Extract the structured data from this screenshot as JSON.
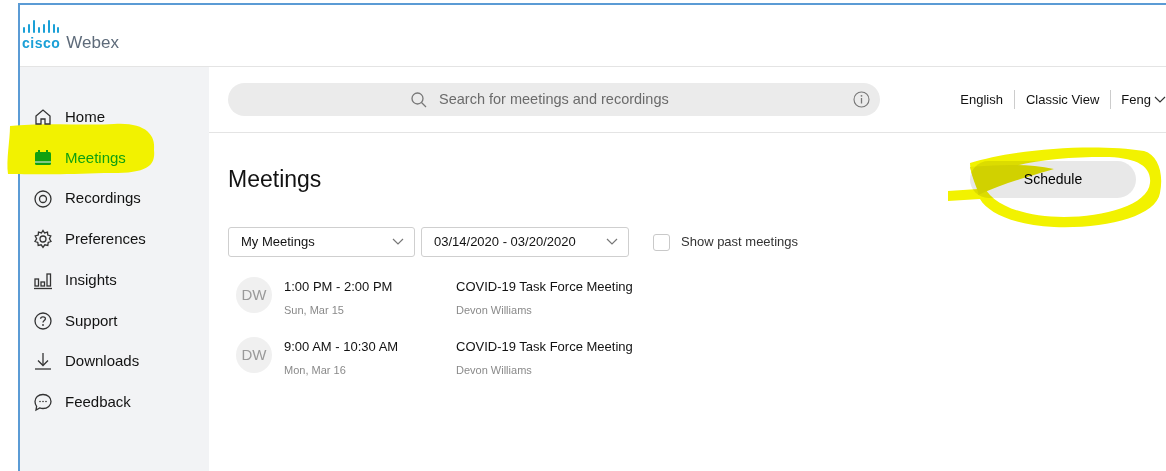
{
  "logo": {
    "brand": "cisco",
    "product": "Webex"
  },
  "sidebar": {
    "items": [
      {
        "label": "Home",
        "kind": "home",
        "selected": false
      },
      {
        "label": "Meetings",
        "kind": "calendar",
        "selected": true
      },
      {
        "label": "Recordings",
        "kind": "record",
        "selected": false
      },
      {
        "label": "Preferences",
        "kind": "gear",
        "selected": false
      },
      {
        "label": "Insights",
        "kind": "chart",
        "selected": false
      },
      {
        "label": "Support",
        "kind": "help",
        "selected": false
      },
      {
        "label": "Downloads",
        "kind": "download",
        "selected": false
      },
      {
        "label": "Feedback",
        "kind": "chat",
        "selected": false
      }
    ]
  },
  "search": {
    "placeholder": "Search for meetings and recordings"
  },
  "top_links": [
    "English",
    "Classic View"
  ],
  "user_menu": {
    "label": "Feng"
  },
  "page_title": "Meetings",
  "schedule_button": "Schedule",
  "filters": {
    "scope": "My Meetings",
    "date_range": "03/14/2020 - 03/20/2020",
    "show_past": {
      "label": "Show past meetings",
      "checked": false
    }
  },
  "meetings": [
    {
      "initials": "DW",
      "time": "1:00 PM - 2:00 PM",
      "date": "Sun, Mar 15",
      "title": "COVID-19 Task Force Meeting",
      "host": "Devon Williams"
    },
    {
      "initials": "DW",
      "time": "9:00 AM - 10:30 AM",
      "date": "Mon, Mar 16",
      "title": "COVID-19 Task Force Meeting",
      "host": "Devon Williams"
    }
  ]
}
